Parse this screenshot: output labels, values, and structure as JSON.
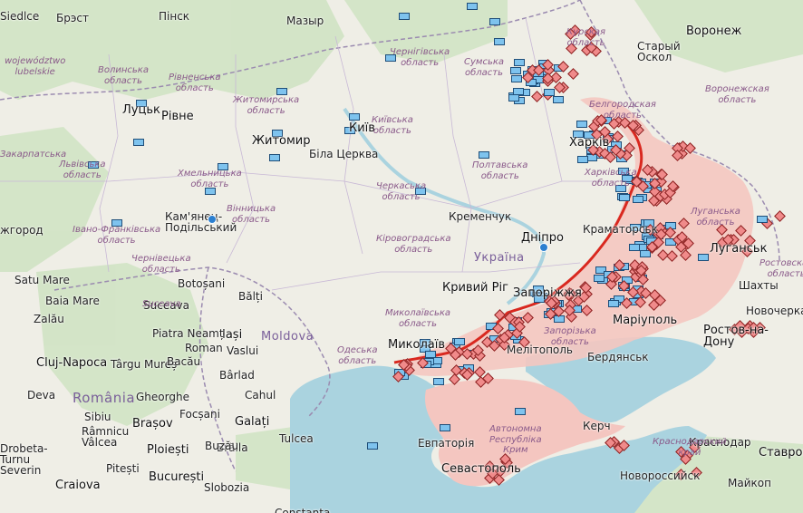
{
  "map": {
    "country_label": "Україна",
    "cities": [
      {
        "id": "brest",
        "name": "Брэст"
      },
      {
        "id": "pinsk",
        "name": "Пінск"
      },
      {
        "id": "mazyr",
        "name": "Мазыр"
      },
      {
        "id": "lutsk",
        "name": "Луцьк"
      },
      {
        "id": "rivne",
        "name": "Рівне"
      },
      {
        "id": "zhytomyr",
        "name": "Житомир"
      },
      {
        "id": "kyiv",
        "name": "Київ"
      },
      {
        "id": "bila-tserkva",
        "name": "Біла Церква"
      },
      {
        "id": "kamianets",
        "name": "Кам'янец-\nПодільський"
      },
      {
        "id": "kremenchuk",
        "name": "Кременчук"
      },
      {
        "id": "dnipro",
        "name": "Дніпро"
      },
      {
        "id": "zaporizhzhia",
        "name": "Запоріжжя"
      },
      {
        "id": "kryvyi-rih",
        "name": "Кривий Ріг"
      },
      {
        "id": "mykolaiv",
        "name": "Миколаїв"
      },
      {
        "id": "mariupol",
        "name": "Маріуполь"
      },
      {
        "id": "kharkiv",
        "name": "Харків"
      },
      {
        "id": "kramatorsk",
        "name": "Краматорськ"
      },
      {
        "id": "luhansk",
        "name": "Луганськ"
      },
      {
        "id": "berdiansk",
        "name": "Бердянськ"
      },
      {
        "id": "melitopol",
        "name": "Мелітополь"
      },
      {
        "id": "yevpatoriia",
        "name": "Евпаторія"
      },
      {
        "id": "sevastopol",
        "name": "Севастополь"
      },
      {
        "id": "kerch",
        "name": "Керч"
      },
      {
        "id": "staryi-oskol",
        "name": "Старый\nОскол"
      },
      {
        "id": "voronezh",
        "name": "Воронеж"
      },
      {
        "id": "rostov",
        "name": "Ростов-на-\nДону"
      },
      {
        "id": "novocherkassk",
        "name": "Новочеркасск"
      },
      {
        "id": "shakhty",
        "name": "Шахты"
      },
      {
        "id": "krasnodar",
        "name": "Краснодар"
      },
      {
        "id": "stavropol",
        "name": "Ставрополь"
      },
      {
        "id": "novorossiysk",
        "name": "Новороссийск"
      },
      {
        "id": "maikop",
        "name": "Майкоп"
      },
      {
        "id": "satu-mare",
        "name": "Satu Mare"
      },
      {
        "id": "baia-mare",
        "name": "Baia Mare"
      },
      {
        "id": "zalau",
        "name": "Zalău"
      },
      {
        "id": "cluj",
        "name": "Cluj-Napoca"
      },
      {
        "id": "targu-mures",
        "name": "Târgu Mureș"
      },
      {
        "id": "brasov",
        "name": "Brașov"
      },
      {
        "id": "deva",
        "name": "Deva"
      },
      {
        "id": "sibiu",
        "name": "Sibiu"
      },
      {
        "id": "ploiesti",
        "name": "Ploiești"
      },
      {
        "id": "bucuresti",
        "name": "București"
      },
      {
        "id": "craiova",
        "name": "Craiova"
      },
      {
        "id": "iasi",
        "name": "Iași"
      },
      {
        "id": "vaslui",
        "name": "Vaslui"
      },
      {
        "id": "barlad",
        "name": "Bârlad"
      },
      {
        "id": "botosani",
        "name": "Botoșani"
      },
      {
        "id": "suceava",
        "name": "Suceava"
      },
      {
        "id": "balti",
        "name": "Bălți"
      },
      {
        "id": "galati",
        "name": "Galați"
      },
      {
        "id": "braila",
        "name": "Brăila"
      },
      {
        "id": "focsani",
        "name": "Focșani"
      },
      {
        "id": "buzau",
        "name": "Buzău"
      },
      {
        "id": "tulcea",
        "name": "Tulcea"
      },
      {
        "id": "constanta",
        "name": "Constanța"
      },
      {
        "id": "piatra-neamt",
        "name": "Piatra Neamț"
      },
      {
        "id": "roman",
        "name": "Roman"
      },
      {
        "id": "bacau",
        "name": "Bacău"
      },
      {
        "id": "gheorghe",
        "name": "Gheorghe"
      },
      {
        "id": "ramnicu",
        "name": "Râmnicu\nVâlcea"
      },
      {
        "id": "pitesti",
        "name": "Pitești"
      },
      {
        "id": "drobeta",
        "name": "Drobeta-\nTurnu\nSeverin"
      },
      {
        "id": "slobozia",
        "name": "Slobozia"
      },
      {
        "id": "cahul",
        "name": "Cahul"
      },
      {
        "id": "uzhhorod",
        "name": "жгород"
      },
      {
        "id": "siedlce",
        "name": "Siedlce"
      }
    ],
    "oblasts": [
      {
        "id": "volyn",
        "name": "Волинська\nобласть"
      },
      {
        "id": "rivne-obl",
        "name": "Рівненська\nобласть"
      },
      {
        "id": "zhytomyr-obl",
        "name": "Житомирська\nобласть"
      },
      {
        "id": "chernihiv-obl",
        "name": "Чернігівська\nобласть"
      },
      {
        "id": "sumy-obl",
        "name": "Сумська\nобласть"
      },
      {
        "id": "kyiv-obl",
        "name": "Київська\nобласть"
      },
      {
        "id": "kursk-obl",
        "name": "Курская\nобласть"
      },
      {
        "id": "belgorod-obl",
        "name": "Белгородская\nобласть"
      },
      {
        "id": "voronezh-obl",
        "name": "Воронежская\nобласть"
      },
      {
        "id": "poltava-obl",
        "name": "Полтавська\nобласть"
      },
      {
        "id": "kharkiv-obl",
        "name": "Харківська\nобласть"
      },
      {
        "id": "cherkasy-obl",
        "name": "Черкаська\nобласть"
      },
      {
        "id": "khmelnytskyi-obl",
        "name": "Хмельницька\nобласть"
      },
      {
        "id": "vinnytsia-obl",
        "name": "Вінницька\nобласть"
      },
      {
        "id": "lviv-obl",
        "name": "Львівська\nобласть"
      },
      {
        "id": "ivano-obl",
        "name": "Івано-Франківська\nобласть"
      },
      {
        "id": "chernivtsi-obl",
        "name": "Чернівецька\nобласть"
      },
      {
        "id": "kirovohrad-obl",
        "name": "Кіровоградська\nобласть"
      },
      {
        "id": "luhansk-obl",
        "name": "Луганська\nобласть"
      },
      {
        "id": "rostov-obl",
        "name": "Ростовская\nобласть"
      },
      {
        "id": "mykolaiv-obl",
        "name": "Миколаївська\nобласть"
      },
      {
        "id": "odesa-obl",
        "name": "Одеська\nобласть"
      },
      {
        "id": "zaporizhzhia-obl",
        "name": "Запорізька\nобласть"
      },
      {
        "id": "crimea",
        "name": "Автономна\nРеспубліка\nКрим"
      },
      {
        "id": "krasnodar-krai",
        "name": "Краснодарский\nкрай"
      },
      {
        "id": "lubelskie",
        "name": "województwo\nlubelskie"
      },
      {
        "id": "zakarpatska",
        "name": "Закарпатська"
      },
      {
        "id": "suceava-co",
        "name": "Suceava"
      }
    ],
    "countries": [
      {
        "id": "romania",
        "name": "România"
      },
      {
        "id": "moldova",
        "name": "Moldova"
      }
    ],
    "colors": {
      "land": "#efeee6",
      "forest": "#cfe3c2",
      "sea": "#aad3df",
      "occupied": "#f4c6c0",
      "frontline": "#d9281f",
      "ua_unit": "#7ec3ee",
      "ru_unit": "#f08a8a",
      "border": "#9b8bb0"
    }
  }
}
